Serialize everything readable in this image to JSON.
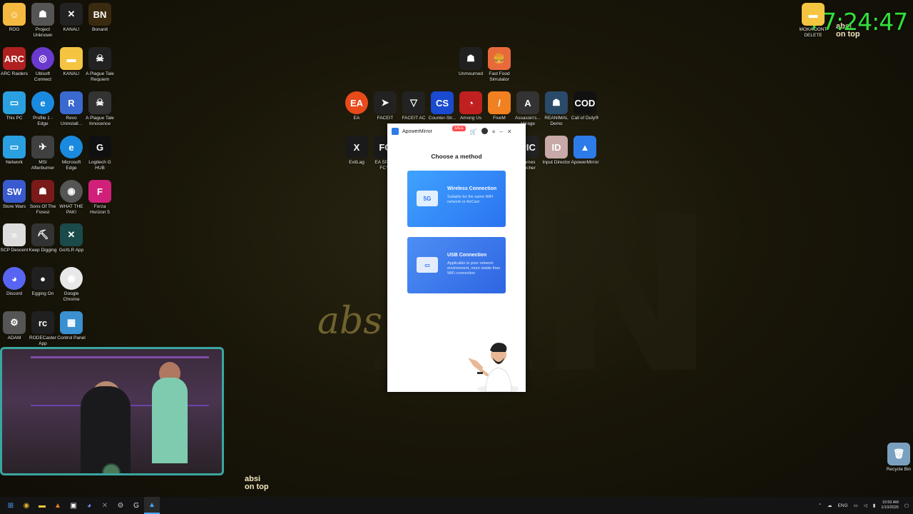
{
  "desktop_icons": [
    {
      "label": "ROG",
      "color": "#f5b942",
      "glyph": "☺"
    },
    {
      "label": "Project Unknown",
      "color": "#555555",
      "glyph": "☗"
    },
    {
      "label": "KANAL!",
      "color": "#222222",
      "glyph": "✕"
    },
    {
      "label": "Bonanit",
      "color": "#3a2a10",
      "glyph": "BN"
    },
    {
      "label": "ARC Raiders",
      "color": "#b02020",
      "glyph": "ARC"
    },
    {
      "label": "Ubisoft Connect",
      "color": "#6a3ad0",
      "glyph": "◎"
    },
    {
      "label": "KANAL!",
      "color": "#f5c542",
      "glyph": "▬"
    },
    {
      "label": "A Plague Tale Requiem",
      "color": "#222222",
      "glyph": "☠"
    },
    {
      "label": "This PC",
      "color": "#2aa0e0",
      "glyph": "▭"
    },
    {
      "label": "Profile 1 - Edge",
      "color": "#1a8ae0",
      "glyph": "e"
    },
    {
      "label": "Revo Uninstall...",
      "color": "#3a6ad0",
      "glyph": "R"
    },
    {
      "label": "A Plague Tale Innocence",
      "color": "#333333",
      "glyph": "☠"
    },
    {
      "label": "Network",
      "color": "#2aa0e0",
      "glyph": "▭"
    },
    {
      "label": "MSI Afterburner",
      "color": "#404040",
      "glyph": "✈"
    },
    {
      "label": "Microsoft Edge",
      "color": "#1a8ae0",
      "glyph": "e"
    },
    {
      "label": "Logitech G HUB",
      "color": "#101010",
      "glyph": "G"
    },
    {
      "label": "Store Wars",
      "color": "#3a5ad0",
      "glyph": "SW"
    },
    {
      "label": "Sons Of The Forest",
      "color": "#7a1a1a",
      "glyph": "☗"
    },
    {
      "label": "WHAT THE PAK!",
      "color": "#555555",
      "glyph": "◉"
    },
    {
      "label": "Forza Horizon 5",
      "color": "#d0207a",
      "glyph": "F"
    },
    {
      "label": "SCP Descent",
      "color": "#dddddd",
      "glyph": "≡"
    },
    {
      "label": "Keep Digging",
      "color": "#333333",
      "glyph": "⛏"
    },
    {
      "label": "GoXLR App",
      "color": "#1a4a4a",
      "glyph": "✕"
    },
    {
      "label": "Discord",
      "color": "#5865f2",
      "glyph": "◕"
    },
    {
      "label": "Egging On",
      "color": "#202020",
      "glyph": "●"
    },
    {
      "label": "Google Chrome",
      "color": "#e8e8e8",
      "glyph": "◉"
    },
    {
      "label": "ADAM",
      "color": "#555555",
      "glyph": "⚙"
    },
    {
      "label": "RODECaster App",
      "color": "#202020",
      "glyph": "rc"
    },
    {
      "label": "Control Panel",
      "color": "#3a90d0",
      "glyph": "▦"
    },
    {
      "label": "Unmourned",
      "color": "#202020",
      "glyph": "☗"
    },
    {
      "label": "Fast Food Simulator",
      "color": "#e86a3a",
      "glyph": "🍔"
    },
    {
      "label": "EA",
      "color": "#e84a1a",
      "glyph": "EA"
    },
    {
      "label": "FACEIT",
      "color": "#222222",
      "glyph": "➤"
    },
    {
      "label": "FACEIT AC",
      "color": "#222222",
      "glyph": "▽"
    },
    {
      "label": "Counter-Str...",
      "color": "#1a4ad0",
      "glyph": "CS"
    },
    {
      "label": "Among Us",
      "color": "#c02020",
      "glyph": "◔"
    },
    {
      "label": "FiveM",
      "color": "#f08020",
      "glyph": "/"
    },
    {
      "label": "Assassin's... Mirage",
      "color": "#333333",
      "glyph": "A"
    },
    {
      "label": "REANIMAL Demo",
      "color": "#2a4a6a",
      "glyph": "☗"
    },
    {
      "label": "Call of Duty®",
      "color": "#111111",
      "glyph": "COD"
    },
    {
      "label": "ExitLag",
      "color": "#1a1a1a",
      "glyph": "X"
    },
    {
      "label": "EA SPO... FC™",
      "color": "#1a1a1a",
      "glyph": "FC"
    },
    {
      "label": "Games ...ncher",
      "color": "#222222",
      "glyph": "PIC"
    },
    {
      "label": "Input Director",
      "color": "#c8a8a8",
      "glyph": "ID"
    },
    {
      "label": "ApowerMirror",
      "color": "#2d7be8",
      "glyph": "▲"
    },
    {
      "label": "MOKA DONT DELETE",
      "color": "#f5c542",
      "glyph": "▬"
    },
    {
      "label": "Recycle Bin",
      "color": "#7aa0c0",
      "glyph": "🗑"
    }
  ],
  "stream_timer": "77:24:47",
  "watermark": {
    "script": "abs",
    "brand": "absi\non top"
  },
  "window": {
    "title": "ApowerMirror",
    "sale_badge": "SALE",
    "heading": "Choose a method",
    "options": [
      {
        "title": "Wireless Connection",
        "desc": "Suitable for the same WiFi network or AirCast",
        "icon_text": "5G"
      },
      {
        "title": "USB Connection",
        "desc": "Applicable to poor network environment, more stable than WiFi connection",
        "icon_text": "▭"
      }
    ]
  },
  "taskbar": {
    "apps": [
      "windows-start",
      "chrome",
      "file-explorer",
      "fivem",
      "store",
      "discord",
      "goxlr",
      "settings",
      "logitech",
      "apowermirror"
    ],
    "tray": {
      "lang": "ENG",
      "time": "10:59 AM",
      "date": "1/10/2026"
    }
  }
}
